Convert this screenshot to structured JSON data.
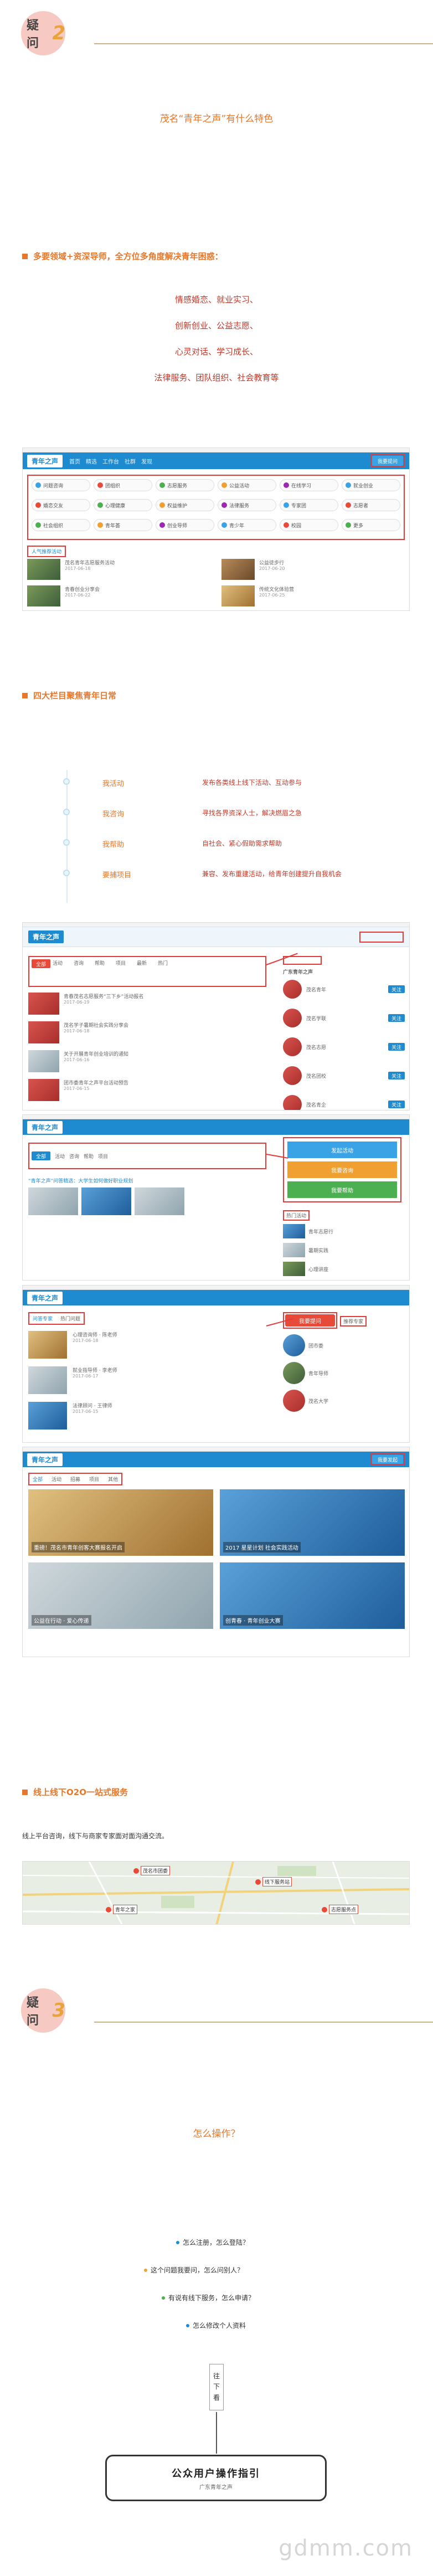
{
  "q2": {
    "label": "疑问",
    "num": "2"
  },
  "q2_heading": "茂名“青年之声”有什么特色",
  "sec1": {
    "title": "多要领域+资深导师，全方位多角度解决青年困惑：",
    "lines": [
      "情感婚恋、就业实习、",
      "创新创业、公益志愿、",
      "心灵对话、学习成长、",
      "法律服务、团队组织、社会教育等"
    ]
  },
  "shot1": {
    "logo": "青年之声",
    "nav": [
      "首页",
      "精选",
      "工作台",
      "社群",
      "发现"
    ],
    "btn": "我要提问",
    "tiles": [
      "问题咨询",
      "团组织",
      "志愿服务",
      "公益活动",
      "在线学习",
      "就业创业",
      "婚恋交友",
      "心理健康",
      "权益维护",
      "法律服务",
      "专家团",
      "志愿者",
      "社会组织",
      "青年荟",
      "创业导师",
      "青少年",
      "校园",
      "更多"
    ],
    "section_label": "人气推荐活动",
    "items": [
      "茂名青年志愿服务活动",
      "公益徒步行",
      "青春创业分享会",
      "传统文化体验营"
    ]
  },
  "sec2": {
    "title": "四大栏目聚焦青年日常",
    "rows": [
      {
        "name": "我活动",
        "desc": "发布各类线上线下活动、互动参与"
      },
      {
        "name": "我咨询",
        "desc": "寻找各界资深人士，解决燃眉之急"
      },
      {
        "name": "我帮助",
        "desc": "自社会、紧心假助需求帮助"
      },
      {
        "name": "要捕项目",
        "desc": "兼容、发布重建活动，给青年创建提升自我机会"
      }
    ]
  },
  "shot2": {
    "logo": "青年之声",
    "filters": [
      "全部",
      "活动",
      "咨询",
      "帮助",
      "项目",
      "最新",
      "热门"
    ],
    "posts": [
      "青春茂名志愿服务“三下乡”活动报名",
      "茂名学子暑期社会实践分享会",
      "关于开展青年创业培训的通知",
      "团市委青年之声平台活动预告"
    ],
    "side_title": "广东青年之声",
    "side_items": [
      "茂名青年",
      "茂名学联",
      "茂名志愿",
      "茂名团校",
      "茂名青企"
    ],
    "side_btn": "关注"
  },
  "shot3": {
    "tabs": [
      "全部",
      "活动",
      "咨询",
      "帮助",
      "项目"
    ],
    "btns": [
      "发起活动",
      "我要咨询",
      "我要帮助"
    ],
    "post": "“青年之声”问答精选：大学生如何做好职业规划",
    "side_title": "热门活动",
    "side_items": [
      "青年志愿行",
      "暑期实践",
      "心理讲座"
    ]
  },
  "shot4": {
    "tabs": [
      "问答专家",
      "热门问题"
    ],
    "btn": "我要提问",
    "items": [
      "心理咨询师 · 陈老师",
      "就业指导师 · 李老师",
      "法律顾问 · 王律师"
    ],
    "side_title": "推荐专家",
    "side_items": [
      "团市委",
      "青年导师",
      "茂名大学"
    ]
  },
  "shot5": {
    "tabs": [
      "全部",
      "活动",
      "招募",
      "项目",
      "其他"
    ],
    "btn": "我要发起",
    "cards": [
      "重磅！茂名市青年创客大赛报名开启",
      "2017 星星计划 社会实践活动",
      "公益在行动 · 爱心传递",
      "创青春 · 青年创业大赛"
    ]
  },
  "sec3": {
    "title": "线上线下O2O一站式服务",
    "text": "线上平台咨询，线下与商家专家面对面沟通交流。",
    "map_labels": [
      "茂名市团委",
      "线下服务站",
      "青年之家",
      "志愿服务点"
    ]
  },
  "q3": {
    "label": "疑问",
    "num": "3"
  },
  "q3_heading": "怎么操作？",
  "q3_items": [
    "怎么注册，怎么登陆？",
    "这个问题我要问，怎么问别人？",
    "有说有线下服务，怎么申请？",
    "怎么修改个人资料"
  ],
  "vertical": [
    "往",
    "下",
    "看"
  ],
  "guide": {
    "title": "公众用户操作指引",
    "sub": "广东青年之声"
  },
  "watermark": "gdmm.com",
  "colors": {
    "accent": "#e8772a",
    "brand_blue": "#1e8bd0",
    "highlight_red": "#e23b3b",
    "badge_pink": "#f7c9c3"
  }
}
